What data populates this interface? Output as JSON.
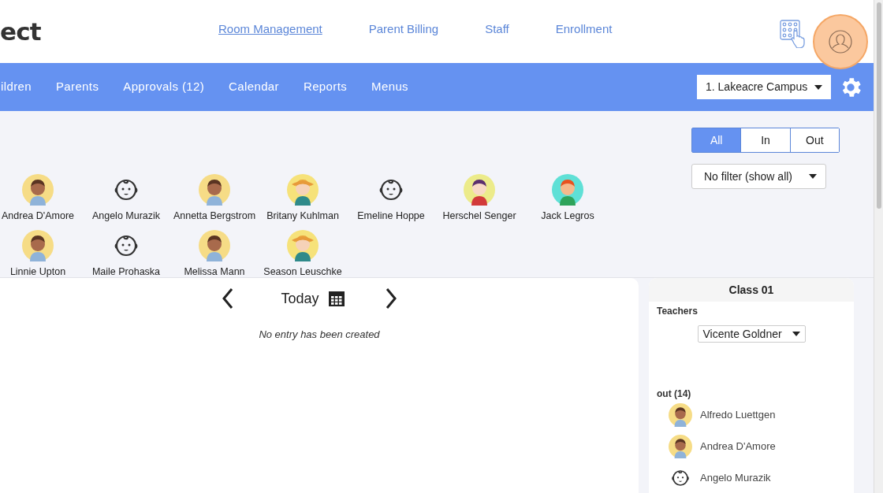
{
  "header": {
    "logo": "ect",
    "links": [
      {
        "label": "Room Management",
        "selected": true
      },
      {
        "label": "Parent Billing",
        "selected": false
      },
      {
        "label": "Staff",
        "selected": false
      },
      {
        "label": "Enrollment",
        "selected": false
      }
    ]
  },
  "nav": {
    "items": [
      "ildren",
      "Parents",
      "Approvals (12)",
      "Calendar",
      "Reports",
      "Menus"
    ],
    "campus": "1. Lakeacre Campus"
  },
  "filters": {
    "segments": [
      {
        "label": "All",
        "selected": true
      },
      {
        "label": "In",
        "selected": false
      },
      {
        "label": "Out",
        "selected": false
      }
    ],
    "dropdown": "No filter (show all)"
  },
  "children": [
    [
      {
        "name": "Andrea D'Amore",
        "kind": "baby"
      },
      {
        "name": "Angelo Murazik",
        "kind": "outline"
      },
      {
        "name": "Annetta Bergstrom",
        "kind": "baby"
      },
      {
        "name": "Britany Kuhlman",
        "kind": "hat"
      },
      {
        "name": "Emeline Hoppe",
        "kind": "outline"
      },
      {
        "name": "Herschel Senger",
        "kind": "girl"
      },
      {
        "name": "Jack Legros",
        "kind": "boy"
      }
    ],
    [
      {
        "name": "Linnie Upton",
        "kind": "baby"
      },
      {
        "name": "Maile Prohaska",
        "kind": "outline"
      },
      {
        "name": "Melissa Mann",
        "kind": "baby"
      },
      {
        "name": "Season Leuschke",
        "kind": "hat"
      }
    ]
  ],
  "schedule": {
    "date": "Today",
    "empty": "No entry has been created"
  },
  "class_panel": {
    "title": "Class 01",
    "teachers_label": "Teachers",
    "teacher": "Vicente Goldner",
    "group_label": "out (14)",
    "members": [
      {
        "name": "Alfredo Luettgen",
        "kind": "baby"
      },
      {
        "name": "Andrea D'Amore",
        "kind": "baby"
      },
      {
        "name": "Angelo Murazik",
        "kind": "outline"
      }
    ]
  }
}
